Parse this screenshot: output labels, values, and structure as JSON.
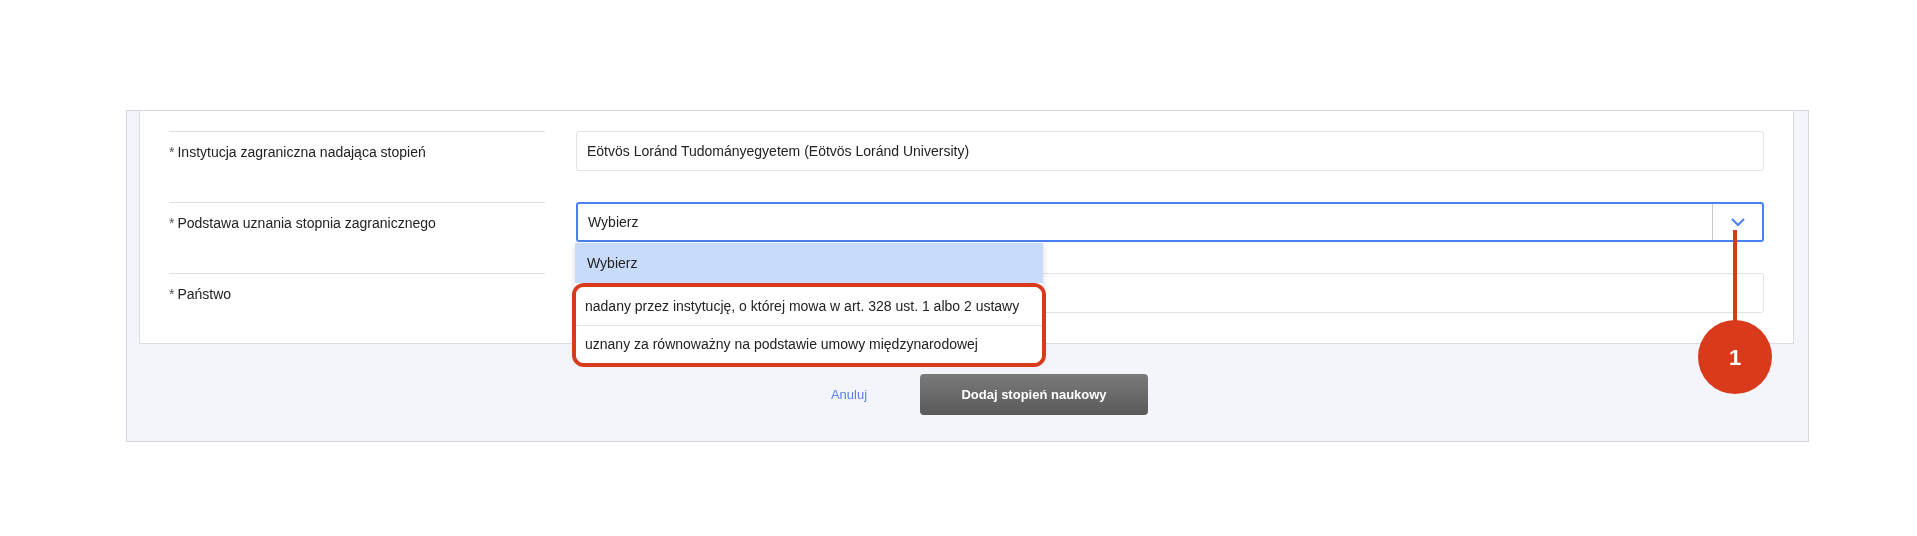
{
  "form": {
    "fields": [
      {
        "kind": "text",
        "label": "Instytucja zagraniczna nadająca stopień",
        "required": true,
        "value": "Eötvös Loránd Tudományegyetem (Eötvös Loránd University)",
        "focused": false
      },
      {
        "kind": "select",
        "label": "Podstawa uznania stopnia zagranicznego",
        "required": true,
        "value": "Wybierz",
        "focused": true,
        "expanded": true,
        "options": [
          {
            "label": "Wybierz",
            "selected": true
          },
          {
            "label": "nadany przez instytucję, o której mowa w art. 328 ust. 1 albo 2 ustawy",
            "selected": false
          },
          {
            "label": "uznany za równoważny na podstawie umowy międzynarodowej",
            "selected": false
          }
        ]
      },
      {
        "kind": "text",
        "label": "Państwo",
        "required": true,
        "focused": false
      }
    ]
  },
  "required_mark": "*",
  "buttons": {
    "cancel": "Anuluj",
    "submit": "Dodaj stopień naukowy"
  },
  "annotation": {
    "number": "1"
  }
}
